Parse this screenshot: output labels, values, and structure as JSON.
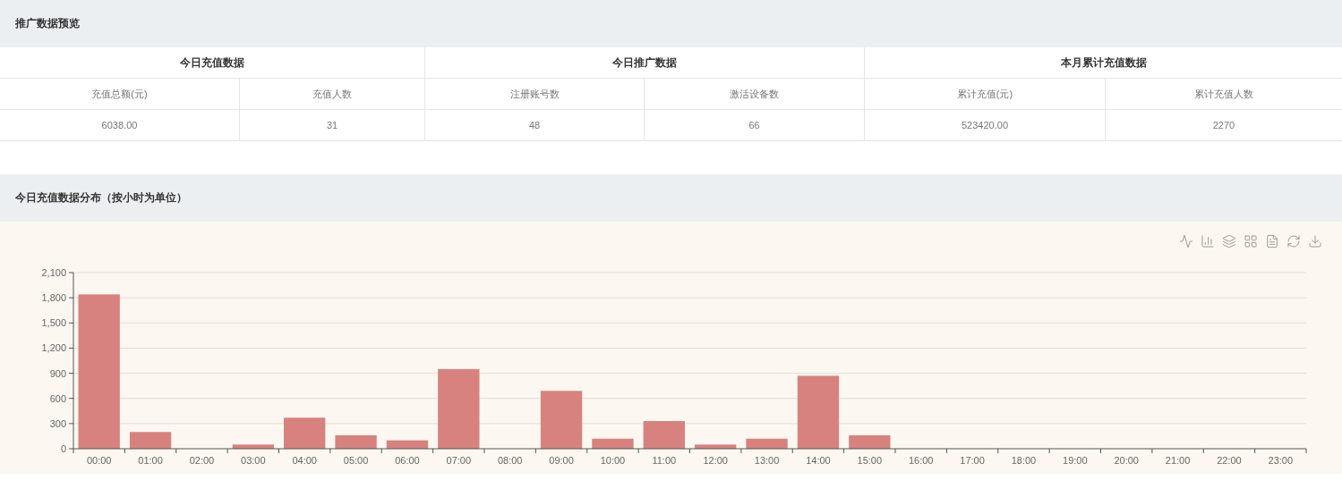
{
  "overview": {
    "title": "推广数据预览",
    "groups": [
      {
        "title": "今日充值数据",
        "columns": [
          {
            "label": "充值总额(元)",
            "value": "6038.00"
          },
          {
            "label": "充值人数",
            "value": "31"
          }
        ]
      },
      {
        "title": "今日推广数据",
        "columns": [
          {
            "label": "注册账号数",
            "value": "48"
          },
          {
            "label": "激活设备数",
            "value": "66"
          }
        ]
      },
      {
        "title": "本月累计充值数据",
        "columns": [
          {
            "label": "累计充值(元)",
            "value": "523420.00"
          },
          {
            "label": "累计充值人数",
            "value": "2270"
          }
        ]
      }
    ]
  },
  "distribution": {
    "title": "今日充值数据分布（按小时为单位）",
    "chart_data": {
      "type": "bar",
      "categories": [
        "00:00",
        "01:00",
        "02:00",
        "03:00",
        "04:00",
        "05:00",
        "06:00",
        "07:00",
        "08:00",
        "09:00",
        "10:00",
        "11:00",
        "12:00",
        "13:00",
        "14:00",
        "15:00",
        "16:00",
        "17:00",
        "18:00",
        "19:00",
        "20:00",
        "21:00",
        "22:00",
        "23:00"
      ],
      "series": [
        {
          "color": "#d8827f",
          "values": [
            1840,
            200,
            0,
            50,
            370,
            160,
            100,
            950,
            0,
            690,
            120,
            330,
            50,
            120,
            870,
            160,
            0,
            0,
            0,
            0,
            0,
            0,
            0,
            0
          ]
        }
      ],
      "ylim": [
        0,
        2100
      ],
      "grid": true,
      "yticks": [
        0,
        300,
        600,
        900,
        {
          "value": 1200,
          "label": "1,200"
        },
        {
          "value": 1500,
          "label": "1,500"
        },
        {
          "value": 1800,
          "label": "1,800"
        },
        {
          "value": 2100,
          "label": "2,100"
        }
      ]
    }
  }
}
